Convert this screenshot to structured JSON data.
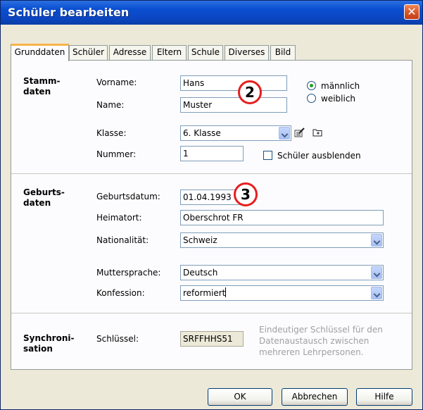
{
  "window": {
    "title": "Schüler bearbeiten",
    "close_icon": "close-icon"
  },
  "tabs": [
    {
      "label": "Grunddaten",
      "active": true
    },
    {
      "label": "Schüler",
      "active": false
    },
    {
      "label": "Adresse",
      "active": false
    },
    {
      "label": "Eltern",
      "active": false
    },
    {
      "label": "Schule",
      "active": false
    },
    {
      "label": "Diverses",
      "active": false
    },
    {
      "label": "Bild",
      "active": false
    }
  ],
  "stammdaten": {
    "section_title_line1": "Stamm-",
    "section_title_line2": "daten",
    "vorname_label": "Vorname:",
    "vorname_value": "Hans",
    "name_label": "Name:",
    "name_value": "Muster",
    "klasse_label": "Klasse:",
    "klasse_value": "6. Klasse",
    "nummer_label": "Nummer:",
    "nummer_value": "1",
    "gender_male": "männlich",
    "gender_female": "weiblich",
    "gender_selected": "männlich",
    "hide_student_label": "Schüler ausblenden",
    "hide_student_checked": false
  },
  "geburtsdaten": {
    "section_title_line1": "Geburts-",
    "section_title_line2": "daten",
    "geburtsdatum_label": "Geburtsdatum:",
    "geburtsdatum_value": "01.04.1993",
    "heimatort_label": "Heimatort:",
    "heimatort_value": "Oberschrot FR",
    "nationalitaet_label": "Nationalität:",
    "nationalitaet_value": "Schweiz",
    "muttersprache_label": "Muttersprache:",
    "muttersprache_value": "Deutsch",
    "konfession_label": "Konfession:",
    "konfession_value": "reformiert"
  },
  "synchronisation": {
    "section_title_line1": "Synchroni-",
    "section_title_line2": "sation",
    "schluessel_label": "Schlüssel:",
    "schluessel_value": "SRFFHHS51",
    "hint_line1": "Eindeutiger Schlüssel für den",
    "hint_line2": "Datenaustausch zwischen",
    "hint_line3": "mehreren Lehrpersonen."
  },
  "markers": {
    "marker_2": "2",
    "marker_3": "3"
  },
  "buttons": {
    "ok": "OK",
    "cancel": "Abbrechen",
    "help": "Hilfe"
  },
  "colors": {
    "titlebar": "#0b47c4",
    "marker_ring": "#e61e1e",
    "active_tab_accent": "#f7b44a"
  }
}
